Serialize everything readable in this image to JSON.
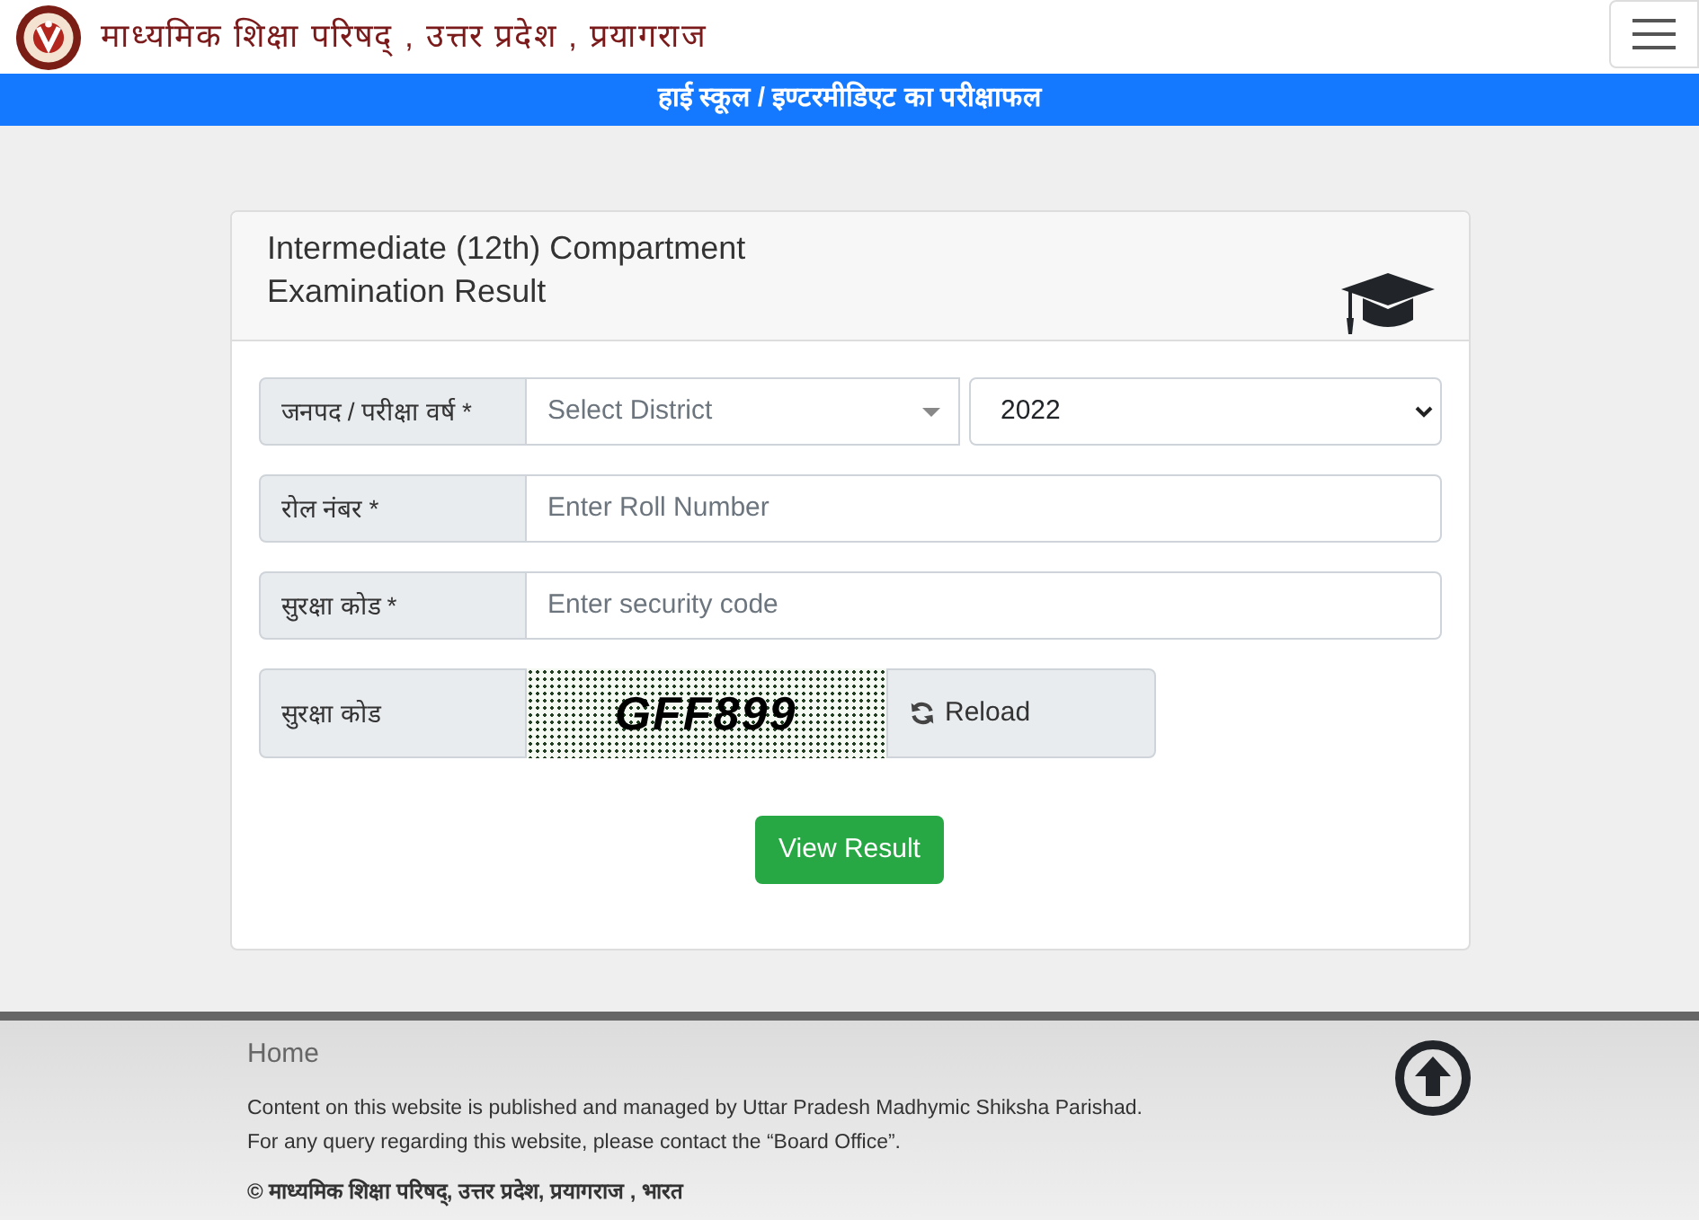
{
  "header": {
    "title": "माध्यमिक शिक्षा परिषद् , उत्तर प्रदेश , प्रयागराज"
  },
  "banner": {
    "title": "हाई स्कूल / इण्टरमीडिएट का परीक्षाफल"
  },
  "card": {
    "title": "Intermediate (12th) Compartment Examination Result",
    "rows": [
      {
        "kind": "select_pair",
        "label": "जनपद / परीक्षा वर्ष *",
        "district": {
          "placeholder": "Select District"
        },
        "year": {
          "value": "2022"
        }
      },
      {
        "kind": "input",
        "label": "रोल नंबर *",
        "placeholder": "Enter Roll Number"
      },
      {
        "kind": "input",
        "label": "सुरक्षा कोड *",
        "placeholder": "Enter security code"
      },
      {
        "kind": "captcha",
        "label": "सुरक्षा कोड",
        "code": "GFF899",
        "button": "Reload"
      }
    ],
    "submit": "View Result"
  },
  "footer": {
    "link": "Home",
    "lines": [
      "Content on this website is published and managed by Uttar Pradesh Madhymic Shiksha Parishad.",
      "For any query regarding this website, please contact the “Board Office”."
    ],
    "copyright": "© माध्यमिक शिक्षा परिषद्, उत्तर प्रदेश, प्रयागराज , भारत"
  }
}
